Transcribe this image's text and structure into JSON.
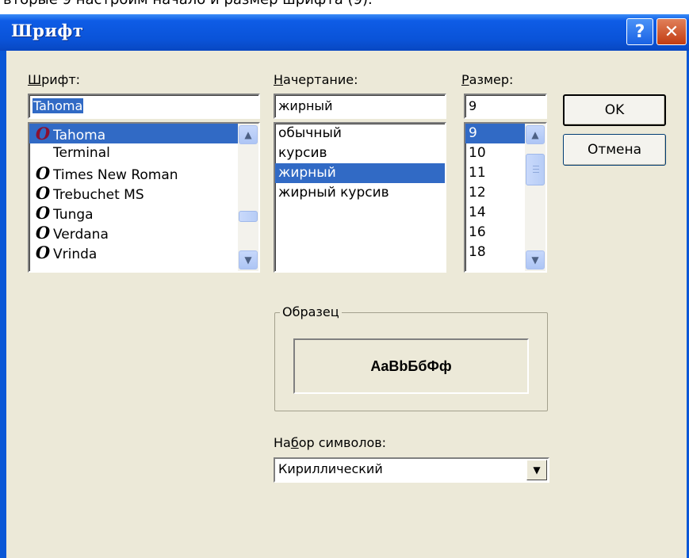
{
  "caption_top": "вторые 9 настроим начало и размер шрифта (9).",
  "dialog": {
    "title": "Шрифт",
    "help_glyph": "?",
    "close_glyph": "✕"
  },
  "font": {
    "label_prefix": "",
    "label_accel": "Ш",
    "label_rest": "рифт:",
    "value": "Tahoma",
    "items": [
      {
        "name": "Tahoma",
        "icon": "O",
        "selected": true
      },
      {
        "name": "Terminal",
        "icon": "",
        "selected": false
      },
      {
        "name": "Times New Roman",
        "icon": "O",
        "selected": false
      },
      {
        "name": "Trebuchet MS",
        "icon": "O",
        "selected": false
      },
      {
        "name": "Tunga",
        "icon": "O",
        "selected": false
      },
      {
        "name": "Verdana",
        "icon": "O",
        "selected": false
      },
      {
        "name": "Vrinda",
        "icon": "O",
        "selected": false
      }
    ]
  },
  "style": {
    "label_accel": "Н",
    "label_rest": "ачертание:",
    "value": "жирный",
    "items": [
      {
        "name": "обычный",
        "selected": false
      },
      {
        "name": "курсив",
        "selected": false
      },
      {
        "name": "жирный",
        "selected": true
      },
      {
        "name": "жирный курсив",
        "selected": false
      }
    ]
  },
  "size": {
    "label_accel": "Р",
    "label_rest": "азмер:",
    "value": "9",
    "items": [
      {
        "name": "9",
        "selected": true
      },
      {
        "name": "10",
        "selected": false
      },
      {
        "name": "11",
        "selected": false
      },
      {
        "name": "12",
        "selected": false
      },
      {
        "name": "14",
        "selected": false
      },
      {
        "name": "16",
        "selected": false
      },
      {
        "name": "18",
        "selected": false
      }
    ]
  },
  "buttons": {
    "ok": "OK",
    "cancel": "Отмена"
  },
  "sample": {
    "legend": "Образец",
    "text": "AaBbБбФф"
  },
  "charset": {
    "label_pre": "На",
    "label_accel": "б",
    "label_post": "ор символов:",
    "value": "Кириллический"
  },
  "icons": {
    "font_type": "truetype-font-icon",
    "scroll_up": "scroll-up-arrow-icon",
    "scroll_down": "scroll-down-arrow-icon",
    "dropdown": "dropdown-arrow-icon"
  },
  "colors": {
    "titlebar": "#0a57d6",
    "selection": "#316ac5",
    "face": "#ece9d8"
  }
}
